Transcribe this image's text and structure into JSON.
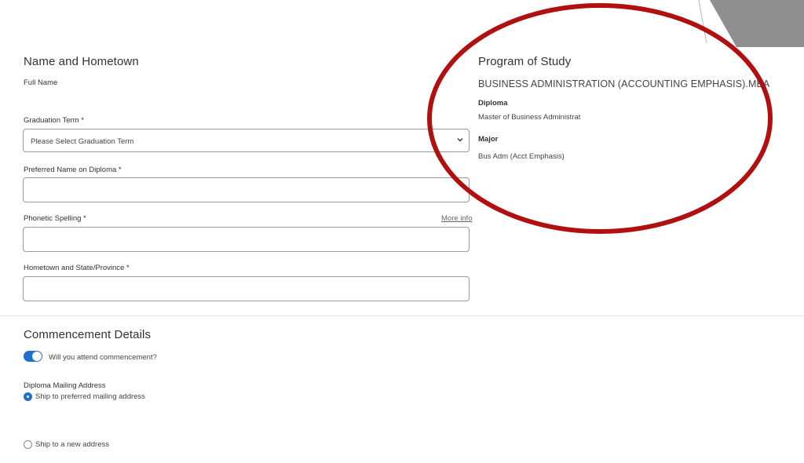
{
  "name_section": {
    "title": "Name and Hometown",
    "full_name_label": "Full Name",
    "graduation_term": {
      "label": "Graduation Term *",
      "value": "Please Select Graduation Term"
    },
    "preferred_name": {
      "label": "Preferred Name on Diploma *",
      "value": ""
    },
    "phonetic_spelling": {
      "label": "Phonetic Spelling *",
      "more_info": "More info",
      "value": ""
    },
    "hometown": {
      "label": "Hometown and State/Province *",
      "value": ""
    }
  },
  "program": {
    "title": "Program of Study",
    "name": "BUSINESS ADMINISTRATION (ACCOUNTING EMPHASIS).MBA",
    "diploma_label": "Diploma",
    "diploma_value": "Master of Business Administrat",
    "major_label": "Major",
    "major_value": "Bus Adm (Acct Emphasis)"
  },
  "commencement": {
    "title": "Commencement Details",
    "attend_label": "Will you attend commencement?",
    "attend_on": true,
    "mailing_label": "Diploma Mailing Address",
    "options": [
      {
        "label": "Ship to preferred mailing address",
        "selected": true
      },
      {
        "label": "Ship to a new address",
        "selected": false
      }
    ]
  },
  "colors": {
    "accent": "#1f6fd1",
    "annotation_circle": "#b01010",
    "corner_shape": "#8f8f8f"
  }
}
